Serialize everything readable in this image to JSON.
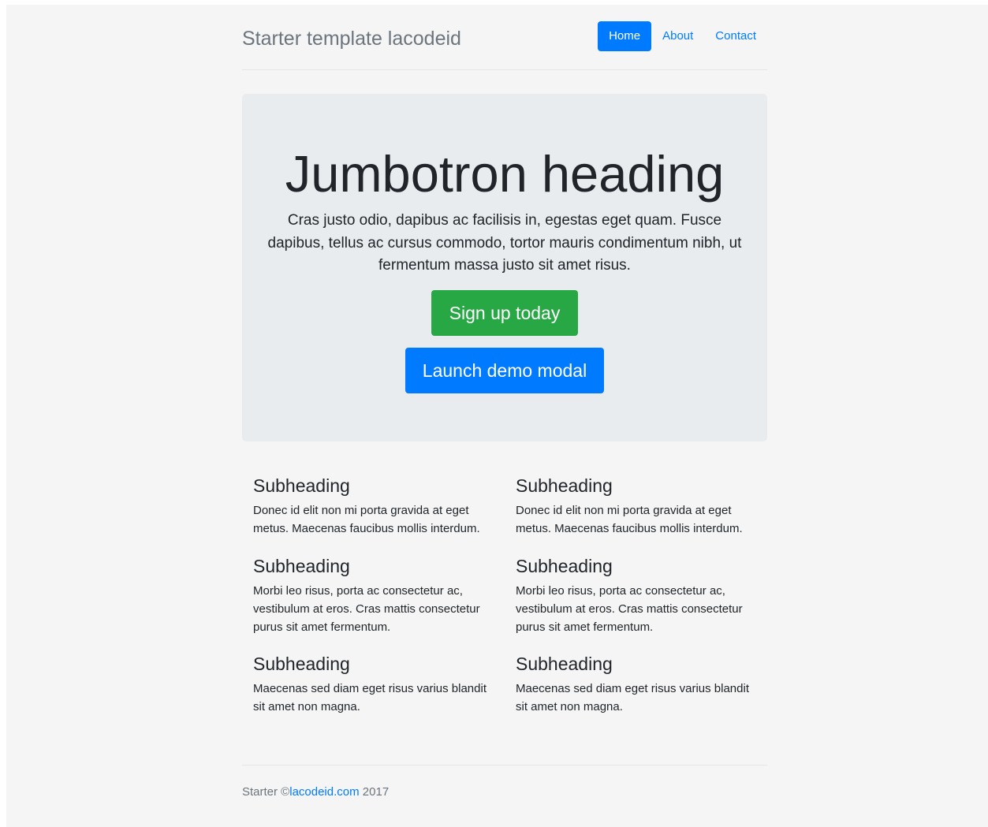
{
  "header": {
    "brand": "Starter template lacodeid",
    "nav": [
      {
        "label": "Home",
        "active": true
      },
      {
        "label": "About",
        "active": false
      },
      {
        "label": "Contact",
        "active": false
      }
    ]
  },
  "jumbotron": {
    "heading": "Jumbotron heading",
    "lead": "Cras justo odio, dapibus ac facilisis in, egestas eget quam. Fusce dapibus, tellus ac cursus commodo, tortor mauris condimentum nibh, ut fermentum massa justo sit amet risus.",
    "signup_label": "Sign up today",
    "modal_label": "Launch demo modal"
  },
  "marketing": {
    "left": [
      {
        "heading": "Subheading",
        "text": "Donec id elit non mi porta gravida at eget metus. Maecenas faucibus mollis interdum."
      },
      {
        "heading": "Subheading",
        "text": "Morbi leo risus, porta ac consectetur ac, vestibulum at eros. Cras mattis consectetur purus sit amet fermentum."
      },
      {
        "heading": "Subheading",
        "text": "Maecenas sed diam eget risus varius blandit sit amet non magna."
      }
    ],
    "right": [
      {
        "heading": "Subheading",
        "text": "Donec id elit non mi porta gravida at eget metus. Maecenas faucibus mollis interdum."
      },
      {
        "heading": "Subheading",
        "text": "Morbi leo risus, porta ac consectetur ac, vestibulum at eros. Cras mattis consectetur purus sit amet fermentum."
      },
      {
        "heading": "Subheading",
        "text": "Maecenas sed diam eget risus varius blandit sit amet non magna."
      }
    ]
  },
  "footer": {
    "prefix": "Starter ©",
    "link_label": "lacodeid.com",
    "suffix": " 2017"
  },
  "colors": {
    "primary": "#007bff",
    "success": "#28a745",
    "jumbotron_bg": "#e9ecef",
    "page_bg": "#f5f5f5",
    "muted": "#6c757d"
  }
}
